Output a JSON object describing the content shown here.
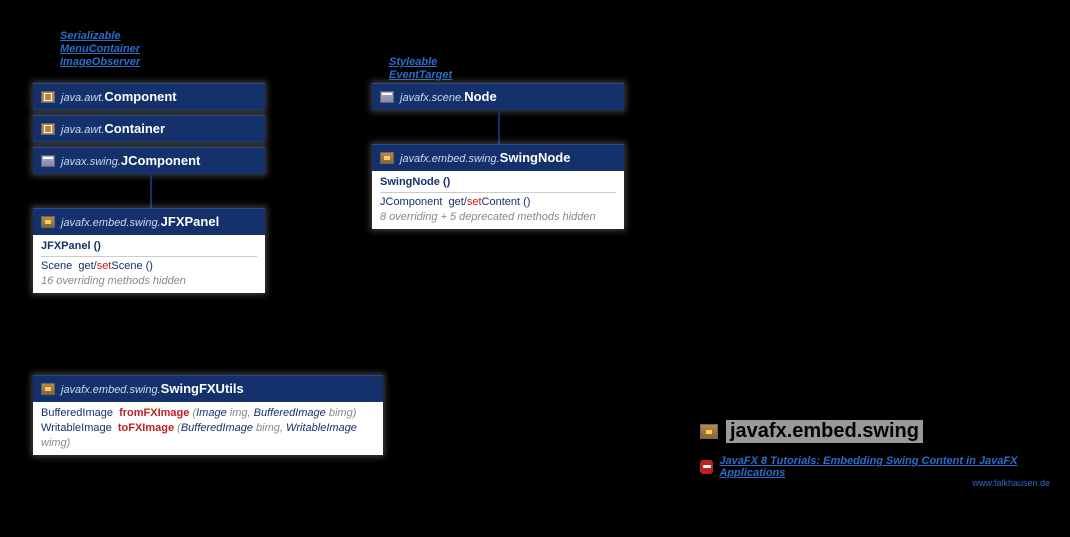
{
  "left_interfaces": [
    "Serializable",
    "MenuContainer",
    "ImageObserver"
  ],
  "right_interfaces": [
    "Styleable",
    "EventTarget"
  ],
  "component": {
    "pkg": "java.awt.",
    "cls": "Component"
  },
  "container": {
    "pkg": "java.awt.",
    "cls": "Container"
  },
  "jcomponent": {
    "pkg": "javax.swing.",
    "cls": "JComponent"
  },
  "jfxpanel": {
    "pkg": "javafx.embed.swing.",
    "cls": "JFXPanel",
    "ctor": "JFXPanel ()",
    "ret": "Scene",
    "getset_pre": "get/",
    "getset_set": "set",
    "getset_post": "Scene ()",
    "hidden_a": "16 overriding",
    "hidden_b": " methods hidden"
  },
  "node": {
    "pkg": "javafx.scene.",
    "cls": "Node"
  },
  "swingnode": {
    "pkg": "javafx.embed.swing.",
    "cls": "SwingNode",
    "ctor": "SwingNode ()",
    "ret": "JComponent",
    "getset_pre": "get/",
    "getset_set": "set",
    "getset_post": "Content ()",
    "hidden_a": "8 overriding + 5 deprecated",
    "hidden_b": " methods hidden"
  },
  "swingfxutils": {
    "pkg": "javafx.embed.swing.",
    "cls": "SwingFXUtils",
    "m1_ret": "BufferedImage",
    "m1_name": "fromFXImage",
    "m1_p1t": "Image",
    "m1_p1n": "img",
    "m1_p2t": "BufferedImage",
    "m1_p2n": "bimg",
    "m2_ret": "WritableImage",
    "m2_name": "toFXImage",
    "m2_p1t": "BufferedImage",
    "m2_p1n": "bimg",
    "m2_p2t": "WritableImage",
    "m2_p2n": "wimg"
  },
  "package_title": "javafx.embed.swing",
  "tutorial": "JavaFX 8 Tutorials: Embedding Swing Content in JavaFX Applications",
  "credit": "www.falkhausen.de"
}
